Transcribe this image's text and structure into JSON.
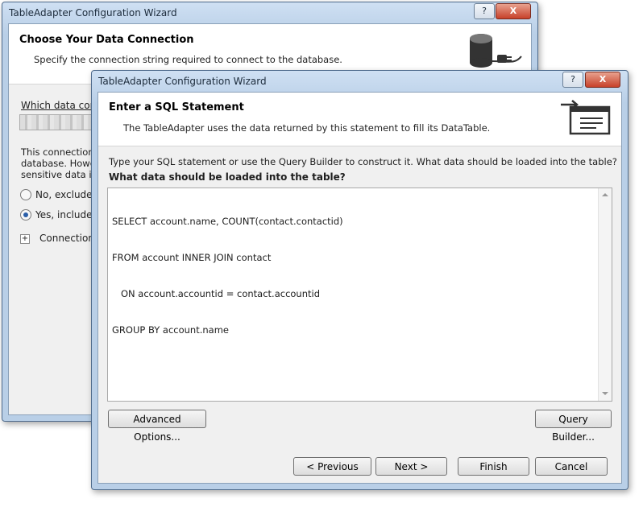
{
  "back_window": {
    "title": "TableAdapter Configuration Wizard",
    "help_btn": "?",
    "close_btn": "X",
    "header_title": "Choose Your Data Connection",
    "header_subtitle": "Specify the connection string required to connect to the database.",
    "which_label": "Which data con",
    "body_lines": [
      "This connection",
      "database. Howev",
      "sensitive data in"
    ],
    "radio_no": "No, exclude s",
    "radio_yes": "Yes, include s",
    "expander": "+",
    "connection_label": "Connection",
    "icon": "database-plug-icon"
  },
  "front_window": {
    "title": "TableAdapter Configuration Wizard",
    "help_btn": "?",
    "close_btn": "X",
    "header_title": "Enter a SQL Statement",
    "header_subtitle": "The TableAdapter uses the data returned by this statement to fill its DataTable.",
    "instruction": "Type your SQL statement or use the Query Builder to construct it. What data should be loaded into the table?",
    "sql_label": "What data should be loaded into the table?",
    "sql_lines": [
      "SELECT account.name, COUNT(contact.contactid)",
      "FROM account INNER JOIN contact",
      "   ON account.accountid = contact.accountid",
      "GROUP BY account.name"
    ],
    "advanced_btn": "Advanced Options...",
    "query_builder_btn": "Query Builder...",
    "previous_btn": "< Previous",
    "next_btn": "Next >",
    "finish_btn": "Finish",
    "cancel_btn": "Cancel",
    "icon": "sql-statement-icon"
  }
}
